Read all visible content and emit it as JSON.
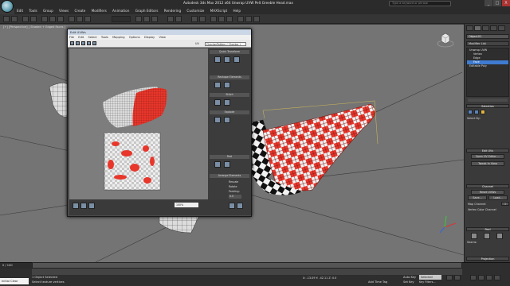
{
  "title_bar": {
    "app_title": "Autodesk 3ds Max 2012 x64  Unwrap UVW Pelt Greeble Head.max",
    "search_placeholder": "Type a keyword or phrase",
    "minimize": "_",
    "maximize": "□",
    "close": "X"
  },
  "menu_bar": {
    "items": [
      "Edit",
      "Tools",
      "Group",
      "Views",
      "Create",
      "Modifiers",
      "Animation",
      "Graph Editors",
      "Rendering",
      "Customize",
      "MAXScript",
      "Help"
    ]
  },
  "viewport": {
    "label": "[+] [Perspective] [ Shaded + Edged Faces ]"
  },
  "command_panel": {
    "object_name": "Object01",
    "modifier_list": "Modifier List",
    "stack_items": [
      {
        "label": "Unwrap UVW",
        "selected": false
      },
      {
        "label": "Vertex",
        "selected": false
      },
      {
        "label": "Edge",
        "selected": false
      },
      {
        "label": "Face",
        "selected": true
      },
      {
        "label": "Editable Poly",
        "selected": false
      }
    ],
    "rollouts": [
      "Selection",
      "Edit UVs",
      "Channel",
      "Peel",
      "Projection"
    ],
    "buttons": {
      "open_uv_editor": "Open UV Editor ...",
      "tweak_in_view": "Tweak In View",
      "reset_uvws": "Reset UVWs",
      "save": "Save...",
      "load": "Load...",
      "map_channel": "Map Channel:",
      "vertex_color_channel": "Vertex Color Channel",
      "channel_value": "1"
    },
    "labels": {
      "select_by": "Select By:",
      "seams": "Seams:",
      "align_options": "Align Options:"
    }
  },
  "uv_editor": {
    "title": "Edit UVWs",
    "menu": [
      "File",
      "Edit",
      "Select",
      "Tools",
      "Mapping",
      "Options",
      "Display",
      "View"
    ],
    "uv_label": "UV",
    "checker_dropdown": "CheckerPattern ( Checker )",
    "sections": [
      "Quick Transform",
      "Reshape Elements",
      "Stitch",
      "Explode",
      "Peel",
      "Arrange Elements"
    ],
    "arrange": {
      "rescale": "Rescale",
      "rotate": "Rotate",
      "padding_label": "Padding:",
      "padding_value": "0.0"
    },
    "zoom_value": "100%"
  },
  "status_bar": {
    "frame": "0 / 100",
    "maxscript_label": "Initial Clear",
    "status_line1": "1 Object Selected",
    "status_line2": "Select texture vertices",
    "coords": "X:  -13.09   Y:  -42.11   Z:  0.0",
    "add_time_tag": "Add Time Tag",
    "auto_key": "Auto Key",
    "selected": "Selected",
    "set_key": "Set Key",
    "key_filters": "Key Filters..."
  },
  "colors": {
    "accent": "#3f7bd0",
    "checker_red": "#e8362b",
    "viewport_bg": "#747474"
  }
}
